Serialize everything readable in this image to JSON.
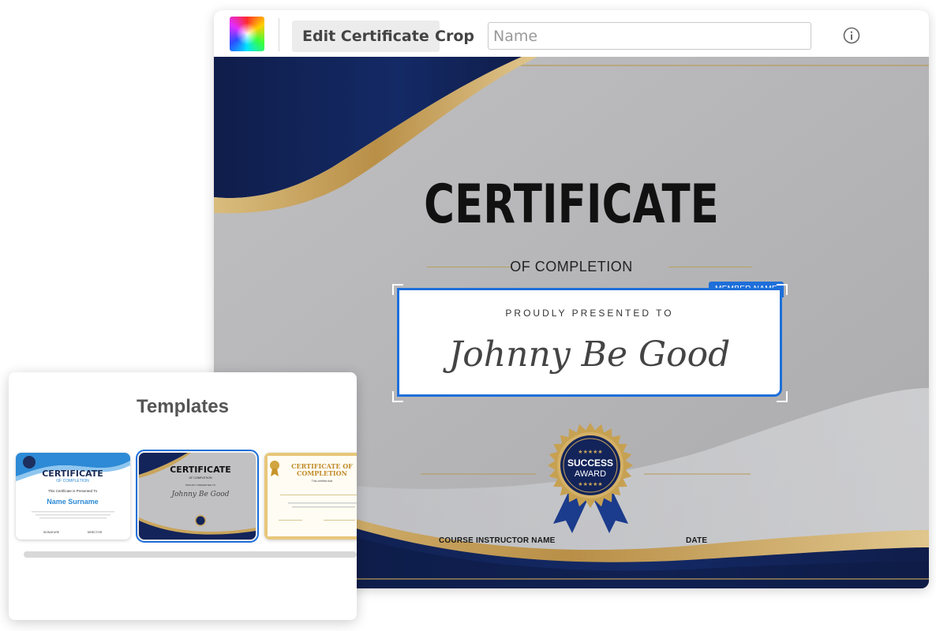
{
  "toolbar": {
    "tab_edit": "Edit Certificate",
    "tab_crop": "Crop",
    "name_placeholder": "Name"
  },
  "certificate": {
    "title": "CERTIFICATE",
    "subtitle": "OF COMPLETION",
    "member_tag": "MEMBER NAME",
    "presented_to": "PROUDLY PRESENTED TO",
    "recipient_name": "Johnny Be Good",
    "instructor_label": "COURSE INSTRUCTOR NAME",
    "date_label": "DATE",
    "seal_text_1": "SUCCESS",
    "seal_text_2": "AWARD",
    "seal_stars": "★★★★★"
  },
  "templates": {
    "title": "Templates",
    "items": [
      {
        "title": "CERTIFICATE",
        "subtitle": "OF COMPLETION",
        "presented": "This Certificate is Presented To",
        "name": "Name  Surname",
        "sign1": "SIGNATURE",
        "sign2": "DIRECTOR"
      },
      {
        "title": "CERTIFICATE",
        "subtitle": "OF COMPLETION",
        "presented": "PROUDLY PRESENTED TO",
        "name": "Johnny Be Good"
      },
      {
        "title": "CERTIFICATE OF",
        "title2": "COMPLETION",
        "presented": "This certifies that"
      }
    ]
  },
  "colors": {
    "navy": "#13245a",
    "gold": "#c9a55c",
    "accent": "#1e6fd9",
    "canvas_gray": "#b8b8ba"
  }
}
